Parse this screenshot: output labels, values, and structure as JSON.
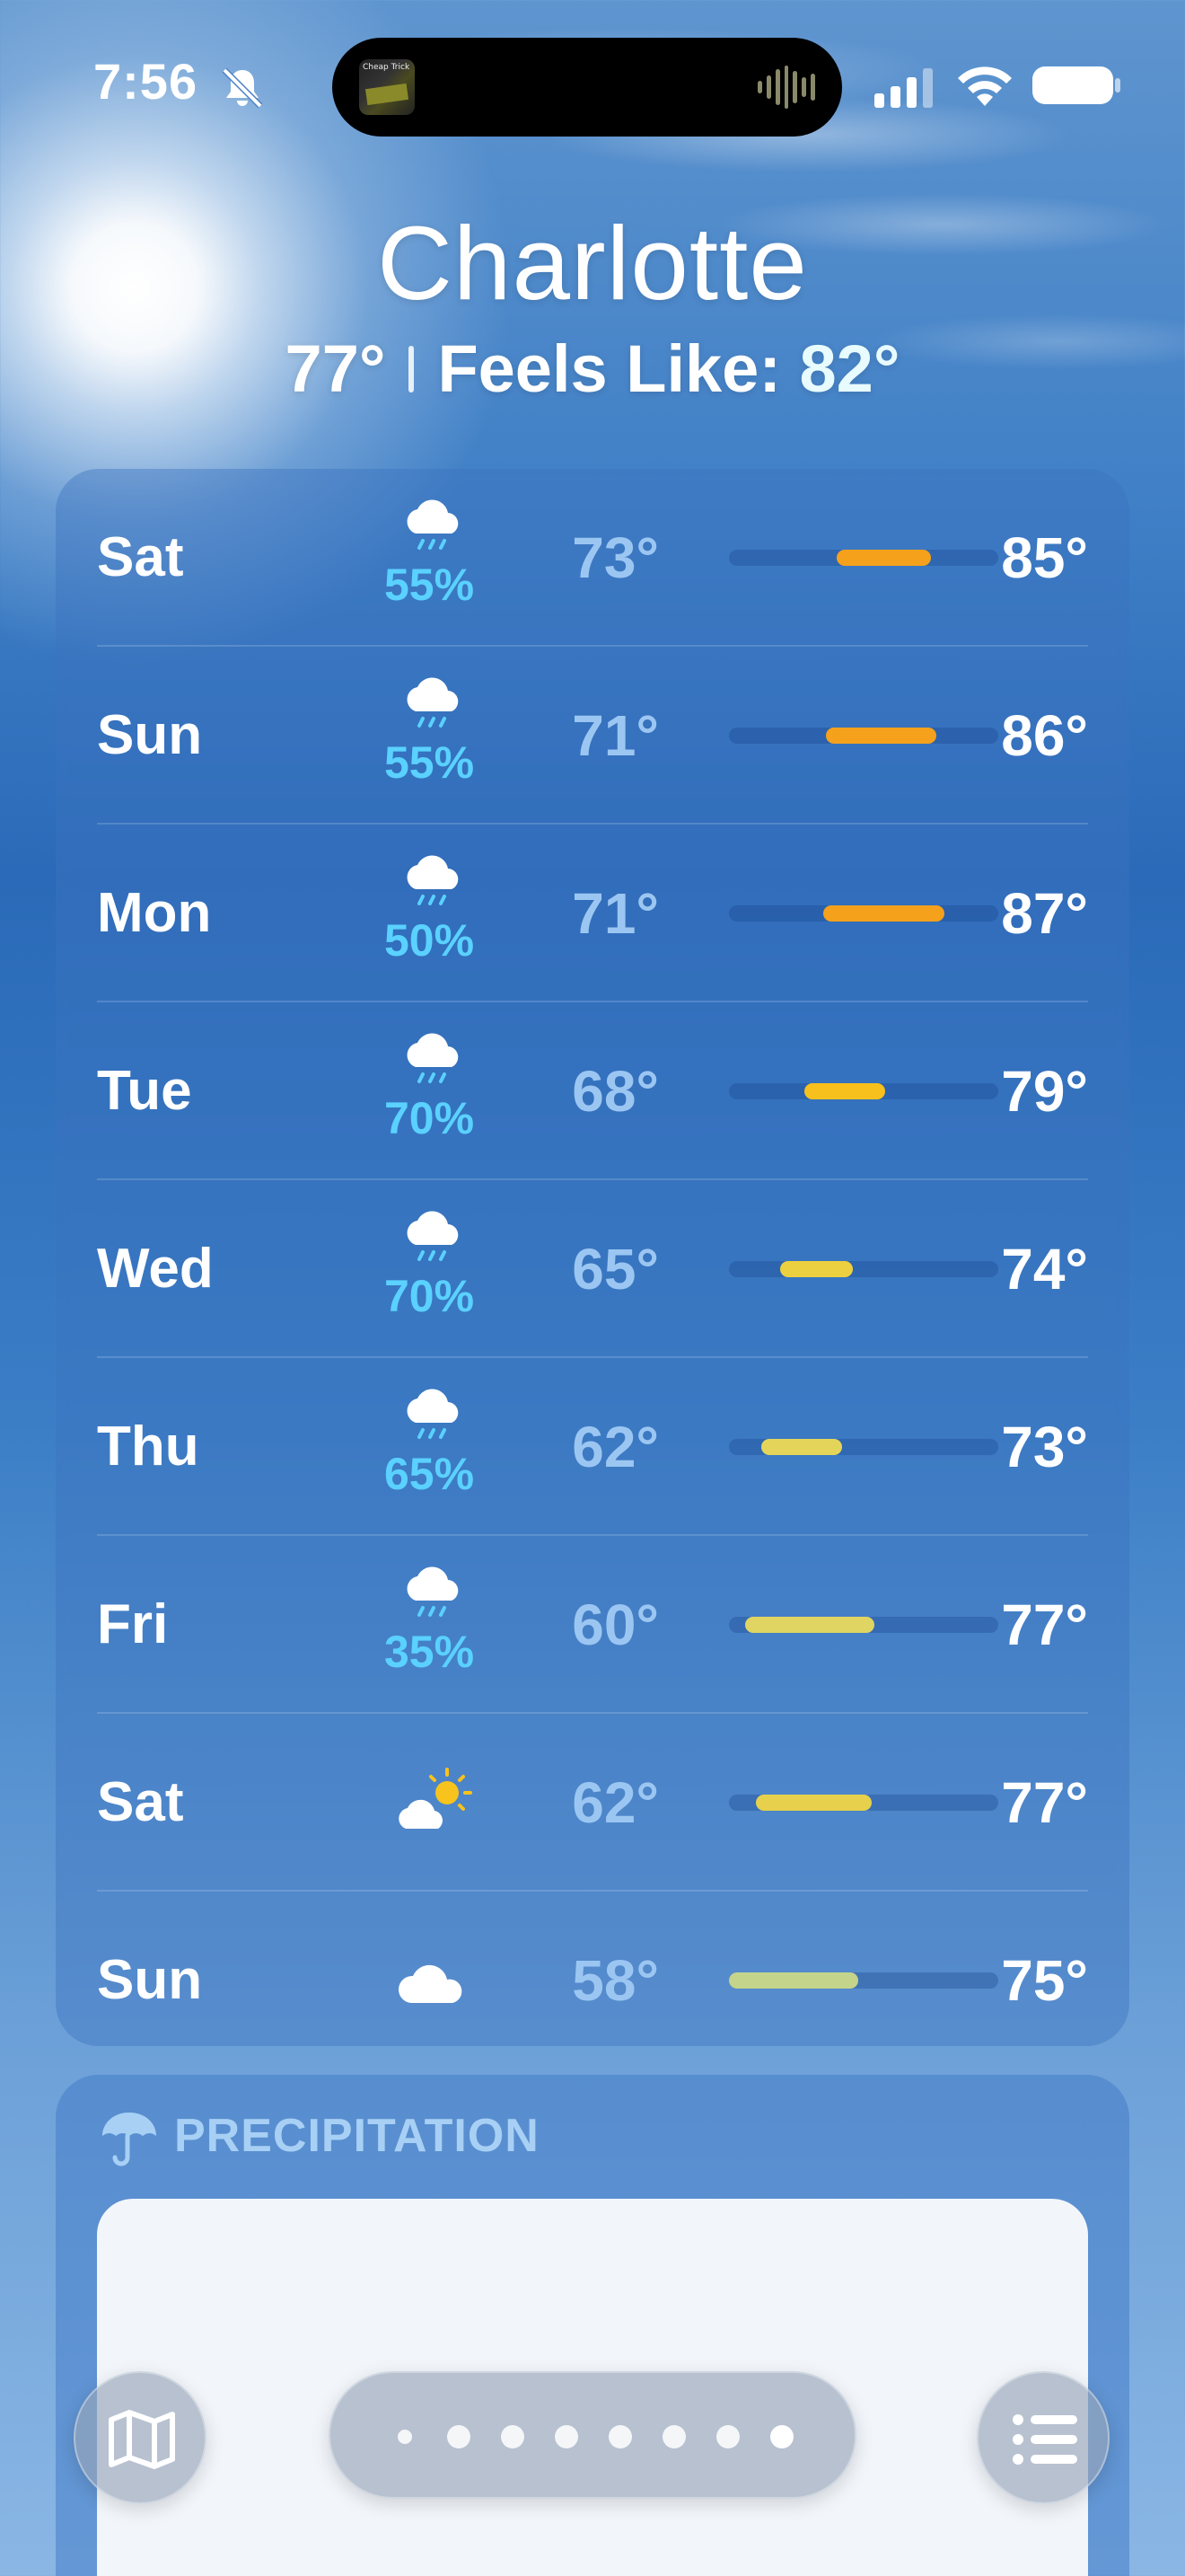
{
  "status_bar": {
    "time": "7:56",
    "now_playing_art_text": "Cheap Trick"
  },
  "header": {
    "city": "Charlotte",
    "current_temp": "77°",
    "feels_like_label": "Feels Like:",
    "feels_like_value": "82°"
  },
  "forecast": {
    "days": [
      {
        "day": "Sat",
        "condition": "rain-cloud-icon",
        "pop": "55%",
        "low": "73°",
        "high": "85°",
        "range_start": 0.4,
        "range_end": 0.75,
        "bar_color": "#f5a11c"
      },
      {
        "day": "Sun",
        "condition": "rain-cloud-icon",
        "pop": "55%",
        "low": "71°",
        "high": "86°",
        "range_start": 0.36,
        "range_end": 0.77,
        "bar_color": "#f5a11c"
      },
      {
        "day": "Mon",
        "condition": "rain-cloud-icon",
        "pop": "50%",
        "low": "71°",
        "high": "87°",
        "range_start": 0.35,
        "range_end": 0.8,
        "bar_color": "#f5a11c"
      },
      {
        "day": "Tue",
        "condition": "rain-cloud-icon",
        "pop": "70%",
        "low": "68°",
        "high": "79°",
        "range_start": 0.28,
        "range_end": 0.58,
        "bar_color": "#f7c01c"
      },
      {
        "day": "Wed",
        "condition": "rain-cloud-icon",
        "pop": "70%",
        "low": "65°",
        "high": "74°",
        "range_start": 0.19,
        "range_end": 0.46,
        "bar_color": "#edd040"
      },
      {
        "day": "Thu",
        "condition": "rain-cloud-icon",
        "pop": "65%",
        "low": "62°",
        "high": "73°",
        "range_start": 0.12,
        "range_end": 0.42,
        "bar_color": "#e4d55a"
      },
      {
        "day": "Fri",
        "condition": "rain-cloud-icon",
        "pop": "35%",
        "low": "60°",
        "high": "77°",
        "range_start": 0.06,
        "range_end": 0.54,
        "bar_color": "#e0d562"
      },
      {
        "day": "Sat",
        "condition": "partly-sunny-icon",
        "pop": "",
        "low": "62°",
        "high": "77°",
        "range_start": 0.1,
        "range_end": 0.53,
        "bar_color": "#e6d04c"
      },
      {
        "day": "Sun",
        "condition": "cloud-icon",
        "pop": "",
        "low": "58°",
        "high": "75°",
        "range_start": 0.0,
        "range_end": 0.48,
        "bar_color": "#c4d48a"
      }
    ]
  },
  "precipitation": {
    "title": "PRECIPITATION"
  },
  "toolbar": {
    "map_icon": "map-icon",
    "list_icon": "list-icon",
    "page_count": 8,
    "active_page": 7
  }
}
